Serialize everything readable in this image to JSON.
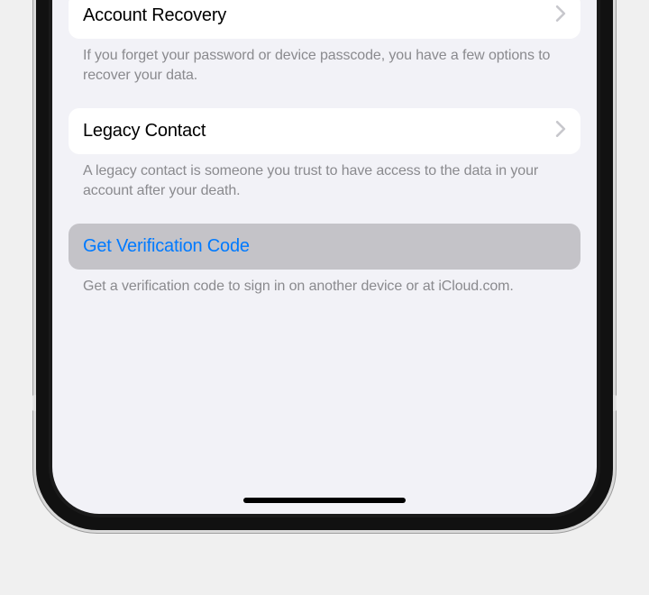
{
  "sections": {
    "accountRecovery": {
      "label": "Account Recovery",
      "footer": "If you forget your password or device passcode, you have a few options to recover your data."
    },
    "legacyContact": {
      "label": "Legacy Contact",
      "footer": "A legacy contact is someone you trust to have access to the data in your account after your death."
    },
    "verificationCode": {
      "label": "Get Verification Code",
      "footer": "Get a verification code to sign in on another device or at iCloud.com."
    }
  }
}
